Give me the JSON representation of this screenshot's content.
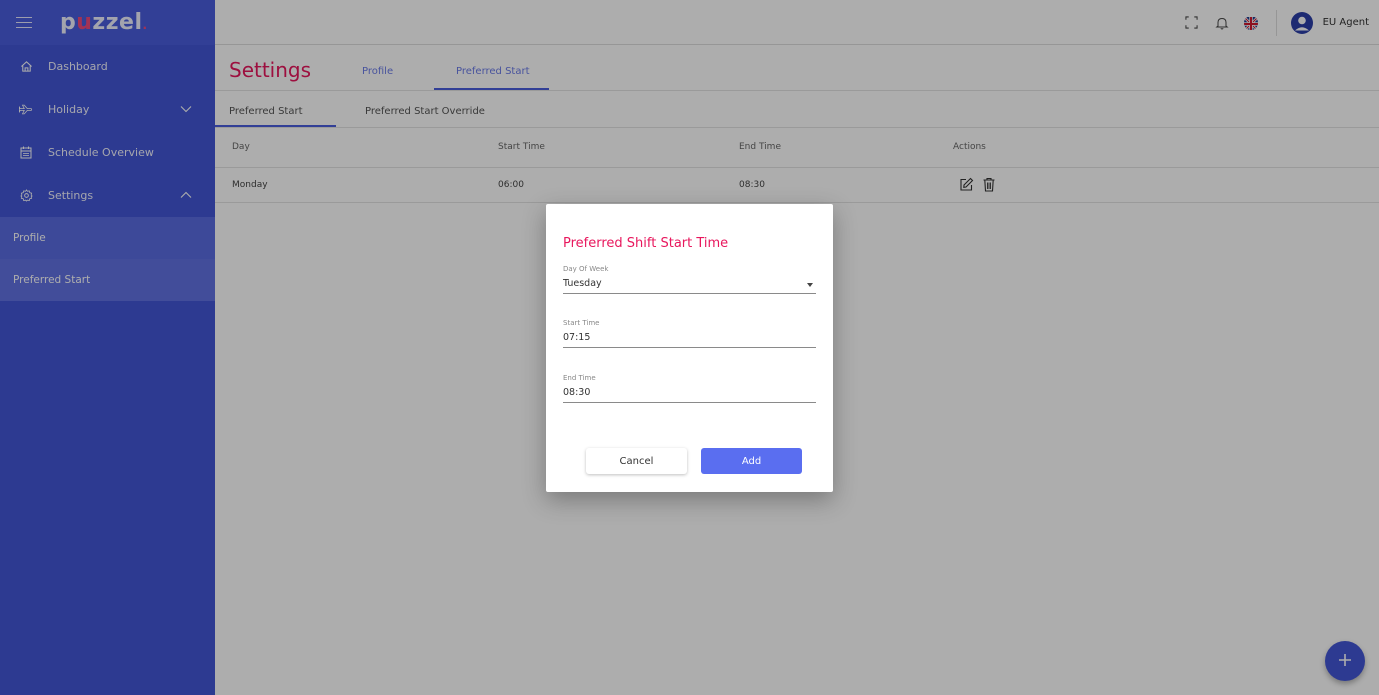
{
  "brand": {
    "logo_prefix": "p",
    "logo_u": "u",
    "logo_suffix": "zzel",
    "logo_dot": ".",
    "accent": "#e8175d",
    "primary": "#4356d6"
  },
  "sidebar": {
    "items": [
      {
        "label": "Dashboard",
        "icon": "home-icon"
      },
      {
        "label": "Holiday",
        "icon": "plane-icon",
        "chevron": "chevron-down-icon"
      },
      {
        "label": "Schedule Overview",
        "icon": "calendar-icon"
      },
      {
        "label": "Settings",
        "icon": "gear-icon",
        "chevron": "chevron-up-icon"
      }
    ],
    "sub_items": [
      {
        "label": "Profile"
      },
      {
        "label": "Preferred Start"
      }
    ]
  },
  "topbar": {
    "icons": [
      "fullscreen-icon",
      "bell-icon",
      "uk-flag-icon",
      "user-avatar-icon"
    ],
    "user_name": "EU Agent"
  },
  "page": {
    "title": "Settings",
    "tabs": [
      {
        "label": "Profile"
      },
      {
        "label": "Preferred Start"
      }
    ],
    "subtabs": [
      {
        "label": "Preferred Start"
      },
      {
        "label": "Preferred Start Override"
      }
    ],
    "table": {
      "headers": {
        "day": "Day",
        "start": "Start Time",
        "end": "End Time",
        "actions": "Actions"
      },
      "rows": [
        {
          "day": "Monday",
          "start": "06:00",
          "end": "08:30"
        }
      ]
    }
  },
  "dialog": {
    "title": "Preferred Shift Start Time",
    "day_label": "Day Of Week",
    "day_value": "Tuesday",
    "start_label": "Start Time",
    "start_value": "07:15",
    "end_label": "End Time",
    "end_value": "08:30",
    "cancel_label": "Cancel",
    "add_label": "Add"
  },
  "fab": {
    "icon": "plus-icon"
  }
}
